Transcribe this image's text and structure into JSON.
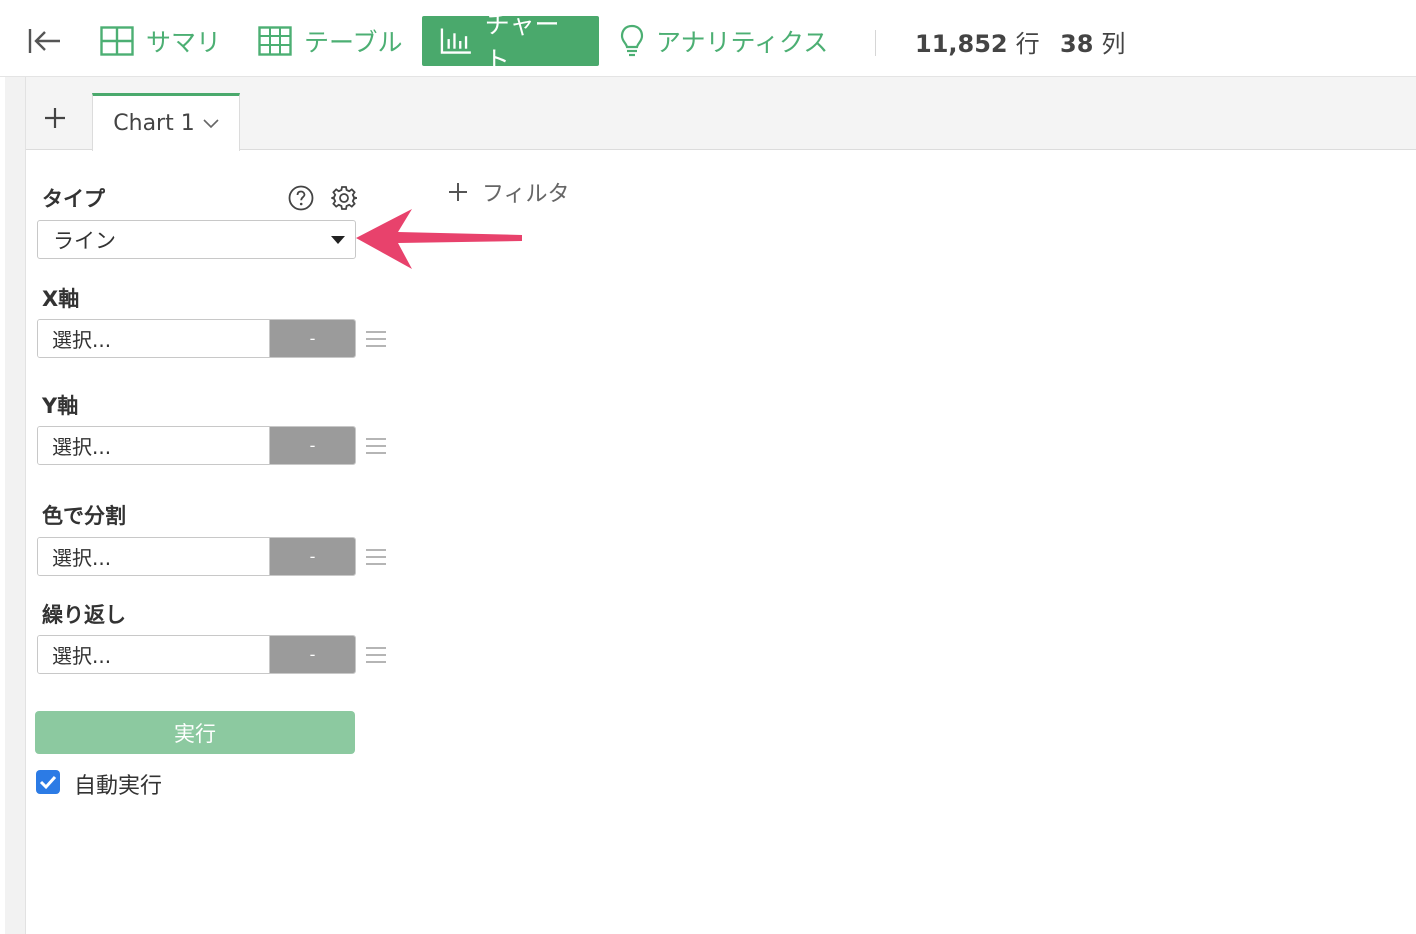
{
  "nav": {
    "summary": "サマリ",
    "table": "テーブル",
    "chart": "チャート",
    "analytics": "アナリティクス"
  },
  "stats": {
    "rows_value": "11,852",
    "rows_unit": "行",
    "cols_value": "38",
    "cols_unit": "列"
  },
  "tabs": [
    {
      "label": "Chart 1"
    }
  ],
  "panel": {
    "type_label": "タイプ",
    "type_value": "ライン",
    "filter_label": "フィルタ",
    "fields": [
      {
        "label": "X軸",
        "placeholder": "選択...",
        "button": "-"
      },
      {
        "label": "Y軸",
        "placeholder": "選択...",
        "button": "-"
      },
      {
        "label": "色で分割",
        "placeholder": "選択...",
        "button": "-"
      },
      {
        "label": "繰り返し",
        "placeholder": "選択...",
        "button": "-"
      }
    ],
    "run_label": "実行",
    "auto_run_label": "自動実行",
    "auto_run_checked": true
  },
  "colors": {
    "accent": "#4aa96c",
    "run_button": "#8cc9a0",
    "checkbox": "#2c7be5",
    "arrow": "#e8426c"
  }
}
